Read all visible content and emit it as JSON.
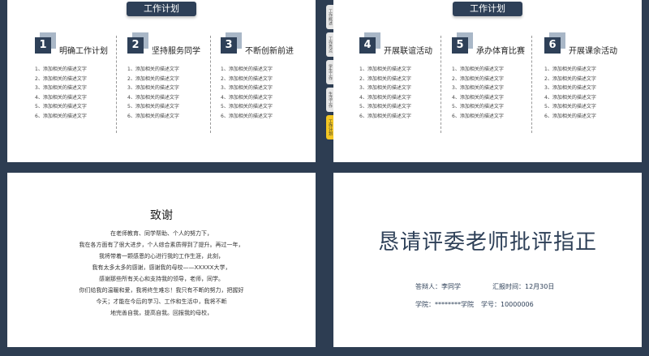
{
  "slide1": {
    "header": "工作计划",
    "columns": [
      {
        "num": "1",
        "title": "明确工作计划",
        "items": [
          "1、添加相关的描述文字",
          "2、添加相关的描述文字",
          "3、添加相关的描述文字",
          "4、添加相关的描述文字",
          "5、添加相关的描述文字",
          "6、添加相关的描述文字"
        ]
      },
      {
        "num": "2",
        "title": "坚持服务同学",
        "items": [
          "1、添加相关的描述文字",
          "2、添加相关的描述文字",
          "3、添加相关的描述文字",
          "4、添加相关的描述文字",
          "5、添加相关的描述文字",
          "6、添加相关的描述文字"
        ]
      },
      {
        "num": "3",
        "title": "不断创新前进",
        "items": [
          "1、添加相关的描述文字",
          "2、添加相关的描述文字",
          "3、添加相关的描述文字",
          "4、添加相关的描述文字",
          "5、添加相关的描述文字",
          "6、添加相关的描述文字"
        ]
      }
    ]
  },
  "slide2": {
    "header": "工作计划",
    "columns": [
      {
        "num": "4",
        "title": "开展联谊活动",
        "items": [
          "1、添加相关的描述文字",
          "2、添加相关的描述文字",
          "3、添加相关的描述文字",
          "4、添加相关的描述文字",
          "5、添加相关的描述文字",
          "6、添加相关的描述文字"
        ]
      },
      {
        "num": "5",
        "title": "承办体育比赛",
        "items": [
          "1、添加相关的描述文字",
          "2、添加相关的描述文字",
          "3、添加相关的描述文字",
          "4、添加相关的描述文字",
          "5、添加相关的描述文字",
          "6、添加相关的描述文字"
        ]
      },
      {
        "num": "6",
        "title": "开展课余活动",
        "items": [
          "1、添加相关的描述文字",
          "2、添加相关的描述文字",
          "3、添加相关的描述文字",
          "4、添加相关的描述文字",
          "5、添加相关的描述文字",
          "6、添加相关的描述文字"
        ]
      }
    ]
  },
  "side_tabs": [
    "工作概述",
    "工作亮点",
    "学生工作",
    "生活工作",
    "工作计划"
  ],
  "slide3": {
    "title": "致谢",
    "lines": [
      "在老师教育、同学帮助、个人的努力下，",
      "我在各方面有了很大进步，个人综合素质得到了提升。再过一年，",
      "我将带着一颗感恩的心进行我的工作生涯，此刻，",
      "我有太多太多的感谢，感谢我的母校——XXXXX大学，",
      "感谢那些所有关心和支持我的领导，老师，同学。",
      "你们给我的温暖和爱，我将终生难忘！我只有不断的努力，把握好",
      "今天；才能在今后的学习、工作和生活中，我将不断",
      "地完善自我，提高自我。回报我的母校，"
    ]
  },
  "slide4": {
    "title": "恳请评委老师批评指正",
    "defender": "答辩人：李同学",
    "report_time": "汇报时间：12月30日",
    "school": "学院：********学院",
    "student_id": "学号：10000006"
  }
}
